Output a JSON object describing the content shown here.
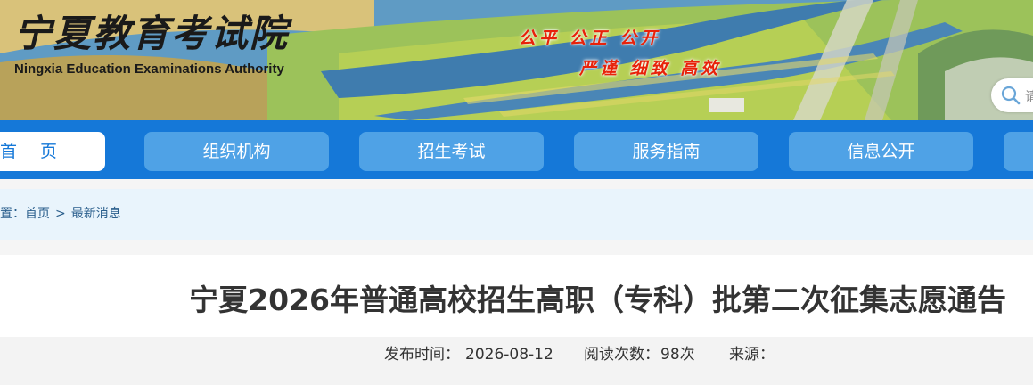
{
  "header": {
    "logo_cn": "宁夏教育考试院",
    "logo_en": "Ningxia Education Examinations Authority",
    "slogan_line1": "公平 公正 公开",
    "slogan_line2": "严谨 细致 高效",
    "search_placeholder": "请"
  },
  "nav": {
    "items": [
      {
        "label": "首 页",
        "active": true
      },
      {
        "label": "组织机构"
      },
      {
        "label": "招生考试"
      },
      {
        "label": "服务指南"
      },
      {
        "label": "信息公开"
      }
    ]
  },
  "breadcrumb": {
    "prefix": "置：",
    "items": [
      "首页",
      "最新消息"
    ],
    "separator": ">"
  },
  "article": {
    "title": "宁夏2026年普通高校招生高职（专科）批第二次征集志愿通告",
    "publish_label": "发布时间：",
    "publish_date": "2026-08-12",
    "views_label": "阅读次数：",
    "views_value": "98次",
    "source_label": "来源："
  },
  "colors": {
    "nav_bg": "#1578d8",
    "nav_item_bg": "#4fa2e6",
    "slogan": "#e8220a",
    "breadcrumb_bg": "#e9f4fc"
  }
}
